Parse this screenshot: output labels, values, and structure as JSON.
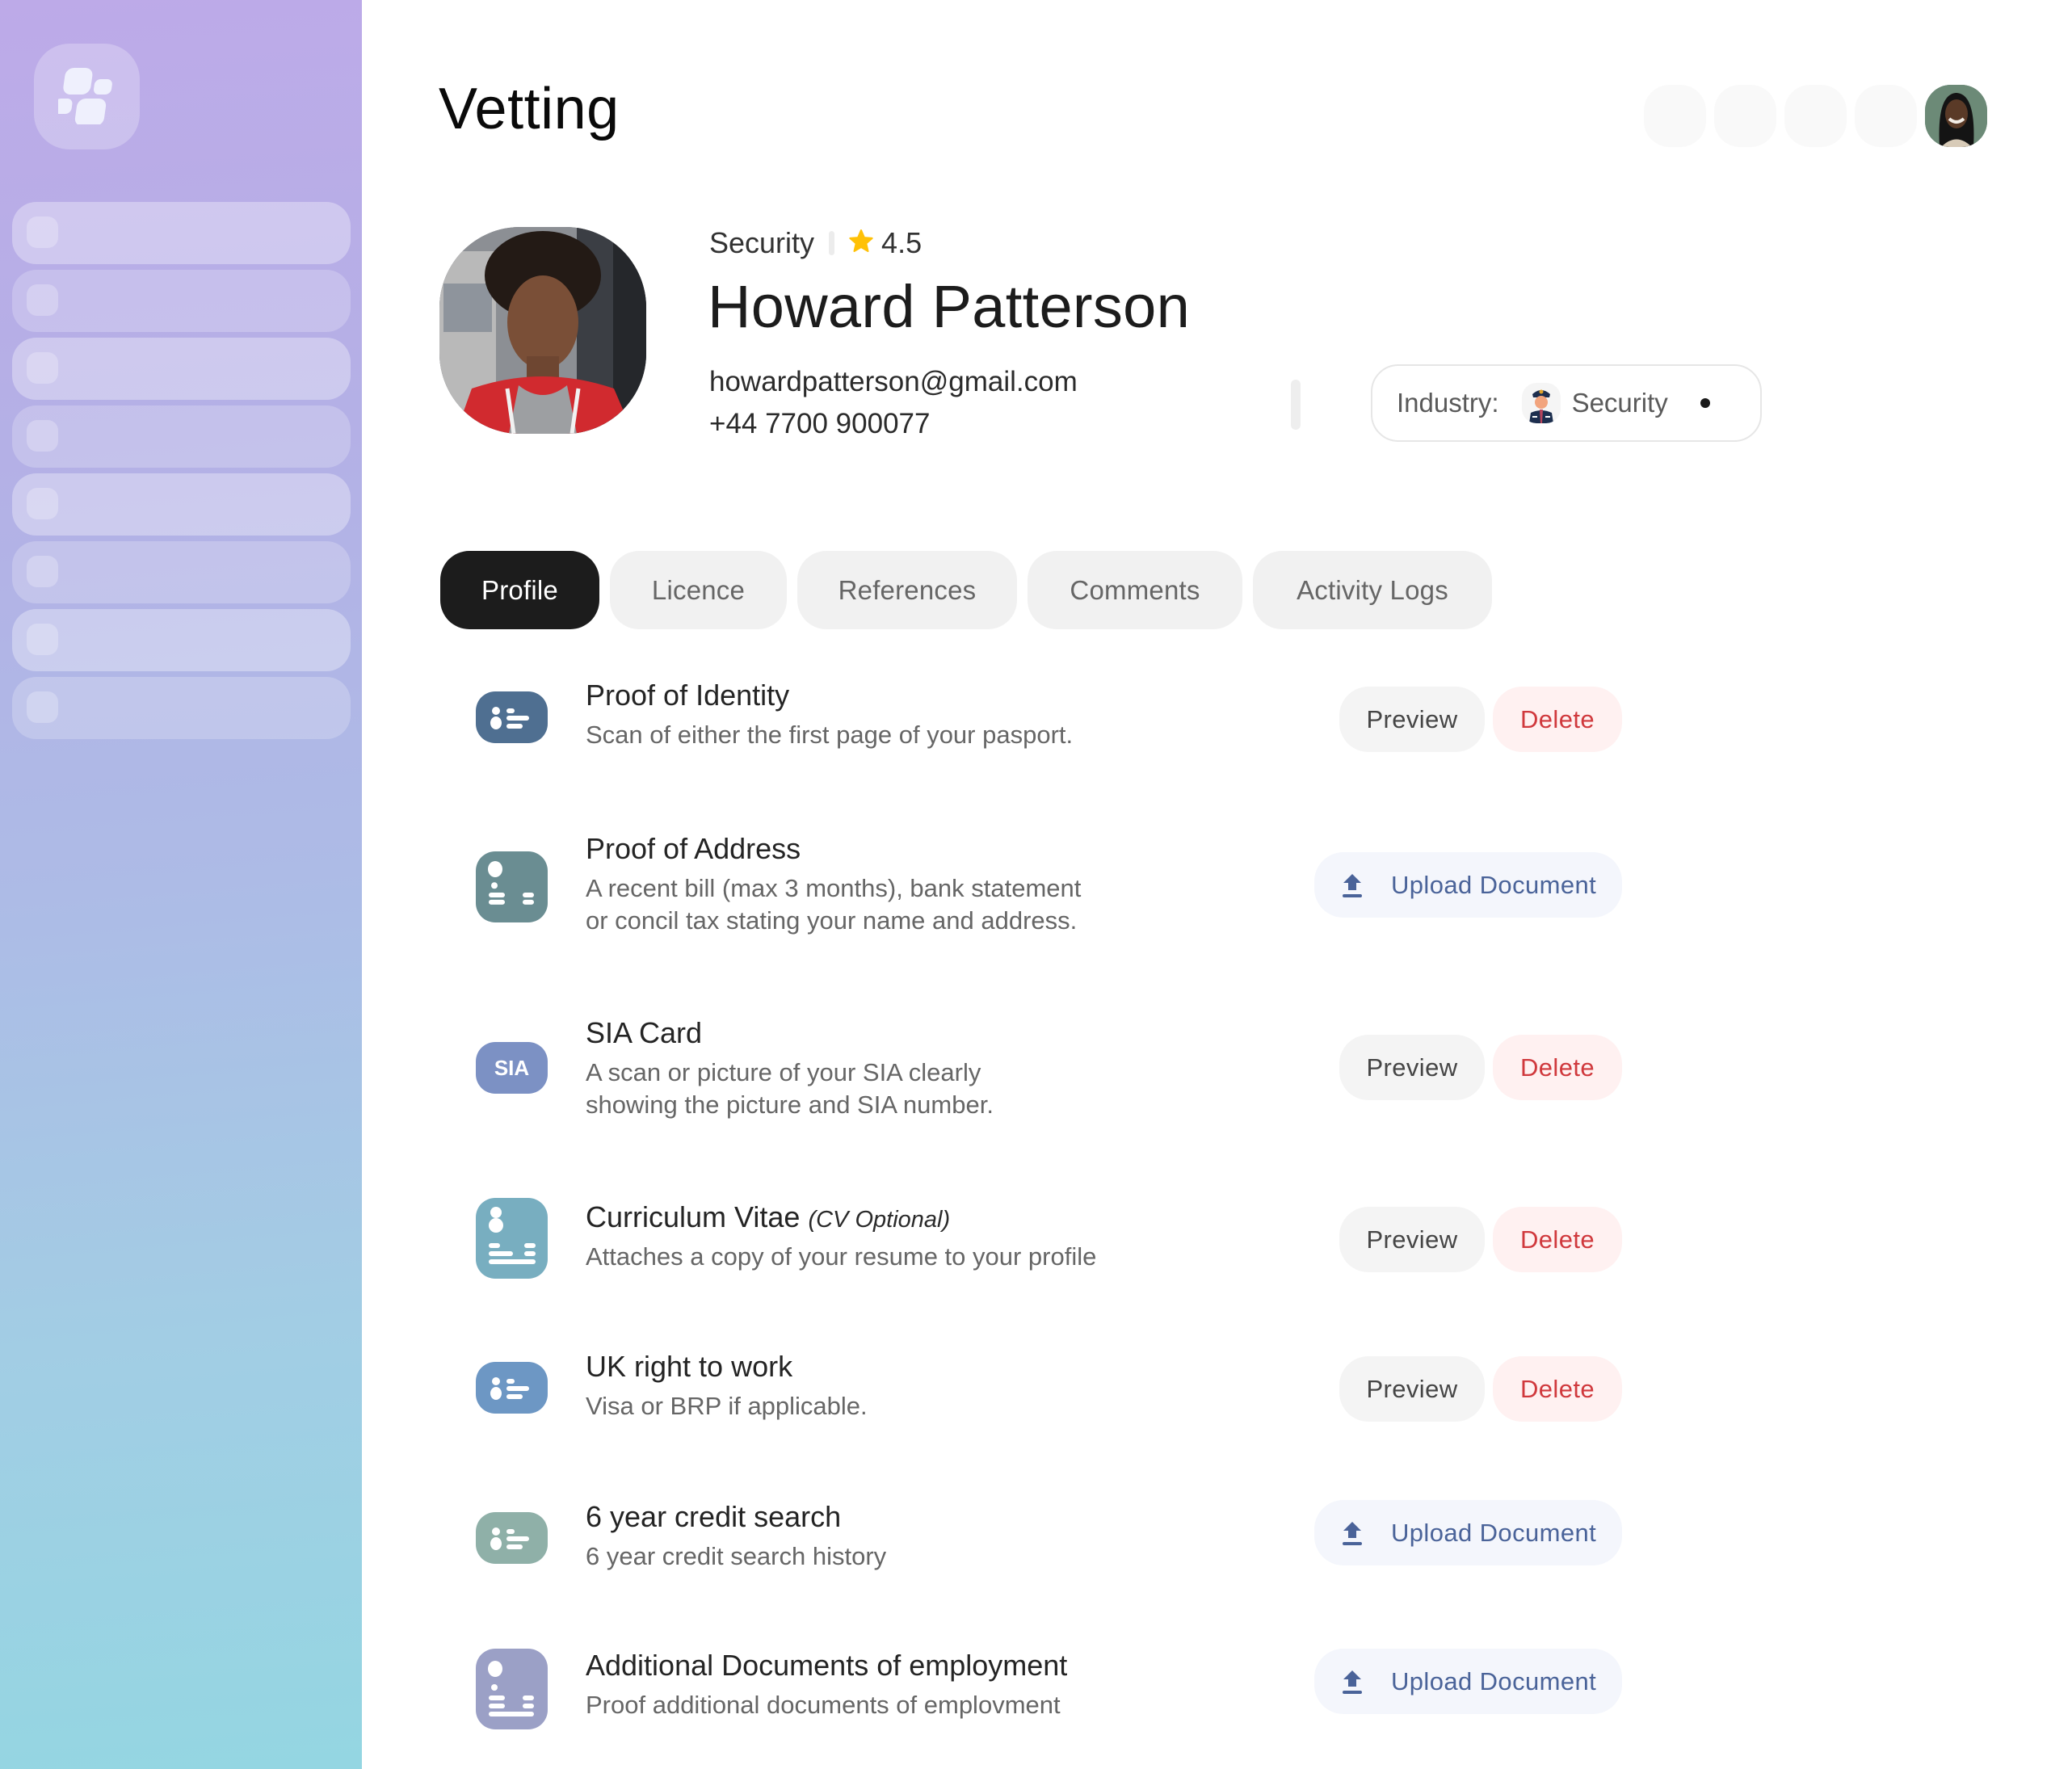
{
  "page": {
    "title": "Vetting"
  },
  "sidebar": {
    "logo": "app-logo",
    "items_count": 8
  },
  "header_actions": [
    {
      "name": "action-1"
    },
    {
      "name": "action-2"
    },
    {
      "name": "action-3"
    },
    {
      "name": "action-4"
    },
    {
      "name": "user-avatar"
    }
  ],
  "profile": {
    "role": "Security",
    "rating": "4.5",
    "name": "Howard Patterson",
    "email": "howardpatterson@gmail.com",
    "phone": "+44 7700 900077"
  },
  "industry": {
    "label": "Industry:",
    "value": "Security"
  },
  "tabs": [
    {
      "label": "Profile",
      "active": true
    },
    {
      "label": "Licence",
      "active": false
    },
    {
      "label": "References",
      "active": false
    },
    {
      "label": "Comments",
      "active": false
    },
    {
      "label": "Activity Logs",
      "active": false
    }
  ],
  "documents": [
    {
      "title": "Proof of Identity",
      "note": "",
      "description": [
        "Scan of either the first page of your pasport."
      ],
      "status": "uploaded",
      "icon": "id-card-icon",
      "icon_color": "#4f6f91",
      "actions": [
        "Preview",
        "Delete"
      ]
    },
    {
      "title": "Proof of Address",
      "note": "",
      "description": [
        "A recent bill (max 3 months), bank statement",
        "or concil tax stating your name and address."
      ],
      "status": "missing",
      "icon": "address-document-icon",
      "icon_color": "#6a8d92",
      "actions": [
        "Upload Document"
      ]
    },
    {
      "title": "SIA Card",
      "note": "",
      "description": [
        "A scan or picture of your SIA clearly",
        "showing the picture and SIA number."
      ],
      "status": "uploaded",
      "icon": "sia-badge-icon",
      "icon_text": "SIA",
      "icon_color": "#7c91c4",
      "actions": [
        "Preview",
        "Delete"
      ]
    },
    {
      "title": "Curriculum Vitae",
      "note": "(CV Optional)",
      "description": [
        "Attaches a copy of your resume to your profile"
      ],
      "status": "uploaded",
      "icon": "cv-document-icon",
      "icon_color": "#78aec0",
      "actions": [
        "Preview",
        "Delete"
      ]
    },
    {
      "title": "UK right to work",
      "note": "",
      "description": [
        "Visa or BRP if applicable."
      ],
      "status": "uploaded",
      "icon": "id-card-icon",
      "icon_color": "#6d97c4",
      "actions": [
        "Preview",
        "Delete"
      ]
    },
    {
      "title": "6 year credit search",
      "note": "",
      "description": [
        "6 year credit search history"
      ],
      "status": "missing",
      "icon": "id-card-icon",
      "icon_color": "#8fb0a8",
      "actions": [
        "Upload Document"
      ]
    },
    {
      "title": "Additional Documents of employment",
      "note": "",
      "description": [
        "Proof additional documents of emplovment"
      ],
      "status": "missing",
      "icon": "employment-document-icon",
      "icon_color": "#9ba0c6",
      "actions": [
        "Upload Document"
      ]
    }
  ],
  "colors": {
    "delete": "#d0393d",
    "upload": "#4a6399",
    "star": "#ffc107",
    "active_tab": "#1c1c1c"
  }
}
